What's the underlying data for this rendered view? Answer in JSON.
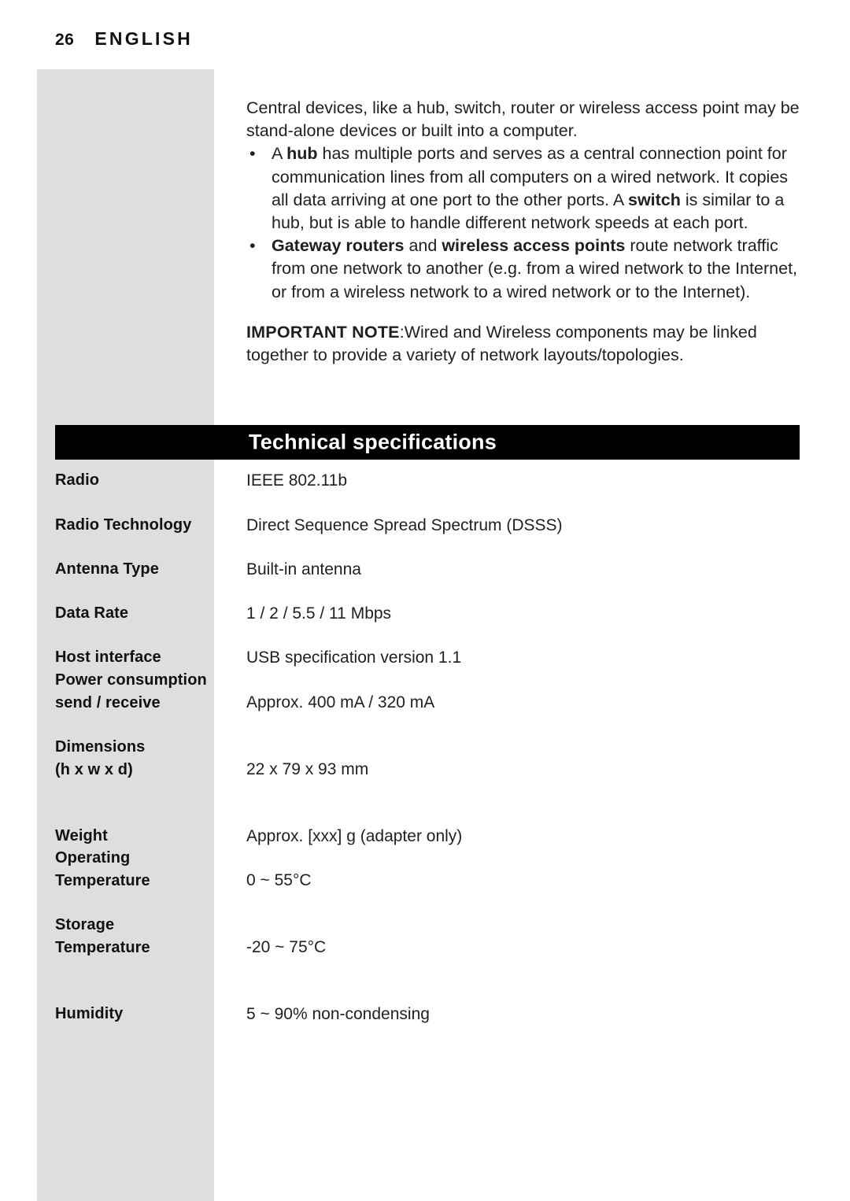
{
  "header": {
    "page_number": "26",
    "section": "ENGLISH"
  },
  "body": {
    "intro_paragraph": "Central devices, like a hub, switch, router or wireless access point may be stand-alone devices or built into a computer.",
    "bullets": [
      {
        "marker": "•",
        "segments": [
          {
            "text": "A ",
            "bold": false
          },
          {
            "text": "hub",
            "bold": true
          },
          {
            "text": " has multiple ports and serves as a central connection point for communication lines from all computers on a wired network. It copies all data arriving at one port to the other ports. A ",
            "bold": false
          },
          {
            "text": "switch",
            "bold": true
          },
          {
            "text": " is similar to a hub, but is able to handle different network speeds at each port.",
            "bold": false
          }
        ]
      },
      {
        "marker": "•",
        "segments": [
          {
            "text": "Gateway routers",
            "bold": true
          },
          {
            "text": " and ",
            "bold": false
          },
          {
            "text": "wireless access points",
            "bold": true
          },
          {
            "text": " route network traffic from one network to another (e.g. from a wired network to the Internet, or from a wireless network to a wired network or to the Internet).",
            "bold": false
          }
        ]
      }
    ],
    "note": {
      "label": "IMPORTANT NOTE",
      "separator": ":",
      "text": "Wired and Wireless components may be linked together to provide a variety of network layouts/topologies."
    }
  },
  "spec_section": {
    "title": "Technical specifications",
    "rows": [
      {
        "label_line1": "Radio",
        "label_line2": "",
        "value": "IEEE 802.11b"
      },
      {
        "label_line1": "Radio Technology",
        "label_line2": "",
        "value": "Direct Sequence Spread Spectrum (DSSS)"
      },
      {
        "label_line1": "Antenna Type",
        "label_line2": "",
        "value": "Built-in antenna"
      },
      {
        "label_line1": "Data Rate",
        "label_line2": "",
        "value": "1 / 2 / 5.5 / 11 Mbps"
      },
      {
        "label_line1": "Host interface",
        "label_line2": "",
        "value": "USB specification version 1.1"
      },
      {
        "label_line1": "Power consumption",
        "label_line2": "send / receive",
        "value": "Approx. 400 mA / 320 mA"
      },
      {
        "label_line1": "Dimensions",
        "label_line2": "(h x w x d)",
        "value": "22 x 79 x 93 mm"
      },
      {
        "label_line1": "Weight",
        "label_line2": "",
        "value": "Approx. [xxx] g (adapter only)"
      },
      {
        "label_line1": "Operating",
        "label_line2": "Temperature",
        "value": "0 ~ 55°C"
      },
      {
        "label_line1": "Storage",
        "label_line2": "Temperature",
        "value": "-20 ~ 75°C"
      },
      {
        "label_line1": "Humidity",
        "label_line2": "",
        "value": "5 ~ 90% non-condensing"
      }
    ]
  },
  "colors": {
    "sidebar_gray": "#dedede",
    "title_bar_background": "#000000",
    "title_bar_text": "#ffffff",
    "body_text": "#1f1f1f"
  }
}
